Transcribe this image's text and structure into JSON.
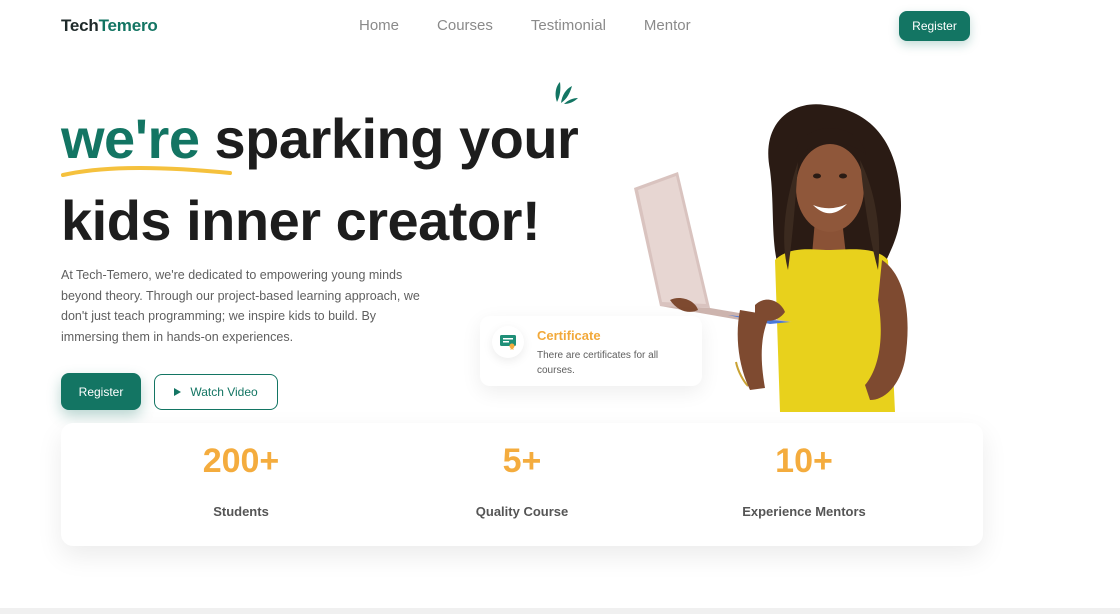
{
  "nav": {
    "logo_part1": "Tech",
    "logo_part2": "Temero",
    "links": [
      "Home",
      "Courses",
      "Testimonial",
      "Mentor"
    ],
    "register_label": "Register"
  },
  "hero": {
    "headline_accent": "we're",
    "headline_rest": "sparking your",
    "headline_line2": "kids inner creator!",
    "description": "At Tech-Temero, we're dedicated to empowering young minds beyond theory. Through our project-based learning approach, we don't just teach programming; we inspire kids to build. By immersing them in hands-on experiences.",
    "register_label": "Register",
    "watch_label": "Watch Video"
  },
  "certificate": {
    "title": "Certificate",
    "text": "There are certificates for all courses."
  },
  "stats": [
    {
      "value": "200+",
      "label": "Students"
    },
    {
      "value": "5+",
      "label": "Quality Course"
    },
    {
      "value": "10+",
      "label": "Experience Mentors"
    }
  ],
  "colors": {
    "brand": "#137563",
    "accent": "#f4ac3e",
    "underline": "#f5c13d"
  }
}
